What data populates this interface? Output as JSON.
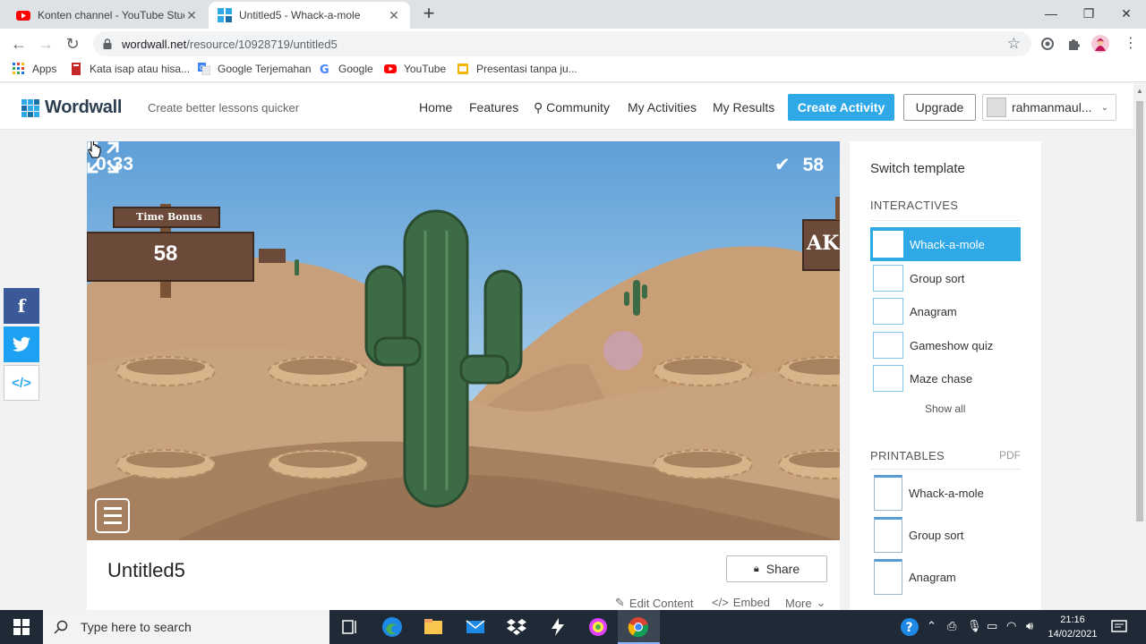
{
  "browser": {
    "tabs": [
      {
        "title": "Konten channel - YouTube Studio"
      },
      {
        "title": "Untitled5 - Whack-a-mole"
      }
    ],
    "url_host": "wordwall.net",
    "url_path": "/resource/10928719/untitled5",
    "bookmarks": [
      {
        "label": "Apps"
      },
      {
        "label": "Kata isap atau hisa..."
      },
      {
        "label": "Google Terjemahan"
      },
      {
        "label": "Google"
      },
      {
        "label": "YouTube"
      },
      {
        "label": "Presentasi tanpa ju..."
      }
    ]
  },
  "header": {
    "logo": "Wordwall",
    "tagline": "Create better lessons quicker",
    "nav": [
      "Home",
      "Features",
      "Community",
      "My Activities",
      "My Results"
    ],
    "create_label": "Create Activity",
    "upgrade_label": "Upgrade",
    "username": "rahmanmaul..."
  },
  "game": {
    "timer": "0:33",
    "score": "58",
    "sign_title": "Time Bonus",
    "sign_value": "58",
    "sign_right_text": "AKI"
  },
  "activity": {
    "title": "Untitled5",
    "share_label": "Share",
    "edit_label": "Edit Content",
    "embed_label": "Embed",
    "more_label": "More"
  },
  "sidebar": {
    "heading": "Switch template",
    "interactives_label": "INTERACTIVES",
    "interactives": [
      {
        "label": "Whack-a-mole",
        "active": true
      },
      {
        "label": "Group sort"
      },
      {
        "label": "Anagram"
      },
      {
        "label": "Gameshow quiz"
      },
      {
        "label": "Maze chase"
      }
    ],
    "show_all": "Show all",
    "printables_label": "PRINTABLES",
    "pdf_label": "PDF",
    "printables": [
      {
        "label": "Whack-a-mole"
      },
      {
        "label": "Group sort"
      },
      {
        "label": "Anagram"
      }
    ]
  },
  "taskbar": {
    "search_placeholder": "Type here to search",
    "time": "21:16",
    "date": "14/02/2021"
  },
  "colors": {
    "accent": "#2fa8e8",
    "facebook": "#3b5998",
    "twitter": "#1da1f2",
    "sky": "#8fc2e8",
    "sand": "#c9a27e",
    "cactus": "#3d6b45"
  }
}
